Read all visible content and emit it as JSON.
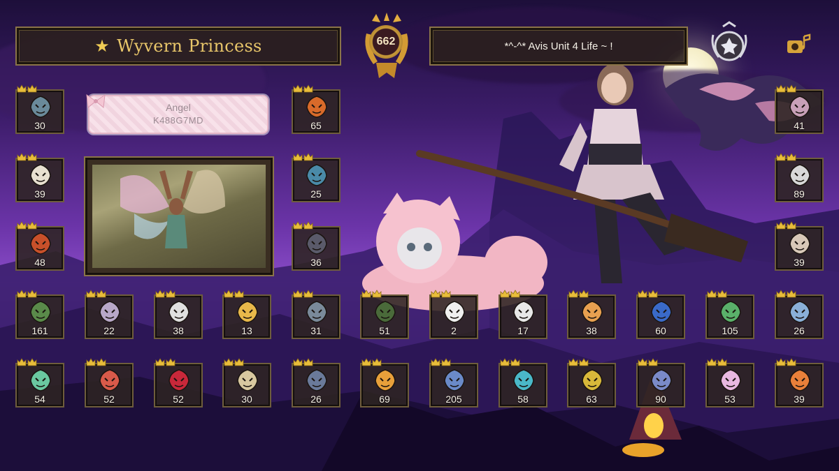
{
  "header": {
    "title": "Wyvern Princess",
    "title_icon": "star-icon",
    "hunter_rank": "662",
    "motto": "*^-^* Avis Unit 4 Life ~ !"
  },
  "profile_card": {
    "name": "Angel",
    "id": "K488G7MD"
  },
  "colors": {
    "accent_gold": "#e8c66a",
    "panel_border": "#8a7448",
    "sky_purple": "#6b34a8"
  },
  "tiles": [
    {
      "count": "30",
      "icon": "dark-wyvern-icon",
      "crowns": 2
    },
    {
      "count": "65",
      "icon": "fire-beast-icon",
      "crowns": 2
    },
    {
      "count": "41",
      "icon": "bird-wyvern-icon",
      "crowns": 2
    },
    {
      "count": "39",
      "icon": "horned-beast-icon",
      "crowns": 2
    },
    {
      "count": "25",
      "icon": "leviathan-icon",
      "crowns": 2
    },
    {
      "count": "89",
      "icon": "silver-wyvern-icon",
      "crowns": 2
    },
    {
      "count": "48",
      "icon": "flame-wyvern-icon",
      "crowns": 2
    },
    {
      "count": "36",
      "icon": "shadow-beast-icon",
      "crowns": 2
    },
    {
      "count": "39",
      "icon": "bone-wyvern-icon",
      "crowns": 2
    },
    {
      "count": "161",
      "icon": "moss-wyvern-icon",
      "crowns": 2
    },
    {
      "count": "22",
      "icon": "ape-beast-icon",
      "crowns": 2
    },
    {
      "count": "38",
      "icon": "wolf-wyvern-icon",
      "crowns": 2
    },
    {
      "count": "13",
      "icon": "golden-wing-icon",
      "crowns": 2
    },
    {
      "count": "31",
      "icon": "armored-beast-icon",
      "crowns": 2
    },
    {
      "count": "51",
      "icon": "insect-icon",
      "crowns": 2
    },
    {
      "count": "2",
      "icon": "white-wyvern-icon",
      "crowns": 2
    },
    {
      "count": "17",
      "icon": "white-crest-icon",
      "crowns": 2
    },
    {
      "count": "38",
      "icon": "thunder-beast-icon",
      "crowns": 2
    },
    {
      "count": "60",
      "icon": "blue-raptor-icon",
      "crowns": 2
    },
    {
      "count": "105",
      "icon": "green-serpent-icon",
      "crowns": 2
    },
    {
      "count": "26",
      "icon": "ice-beast-icon",
      "crowns": 2
    },
    {
      "count": "54",
      "icon": "frog-beast-icon",
      "crowns": 2
    },
    {
      "count": "52",
      "icon": "coral-serpent-icon",
      "crowns": 2
    },
    {
      "count": "52",
      "icon": "red-rose-icon",
      "crowns": 2
    },
    {
      "count": "30",
      "icon": "sand-beast-icon",
      "crowns": 2
    },
    {
      "count": "26",
      "icon": "storm-wyvern-icon",
      "crowns": 2
    },
    {
      "count": "69",
      "icon": "orange-blob-icon",
      "crowns": 2
    },
    {
      "count": "205",
      "icon": "fire-dragon-icon",
      "crowns": 2
    },
    {
      "count": "58",
      "icon": "teal-serpent-icon",
      "crowns": 2
    },
    {
      "count": "63",
      "icon": "gold-beast-icon",
      "crowns": 2
    },
    {
      "count": "90",
      "icon": "crystal-dragon-icon",
      "crowns": 2
    },
    {
      "count": "53",
      "icon": "pink-jelly-icon",
      "crowns": 2
    },
    {
      "count": "39",
      "icon": "ember-dragon-icon",
      "crowns": 2
    }
  ]
}
